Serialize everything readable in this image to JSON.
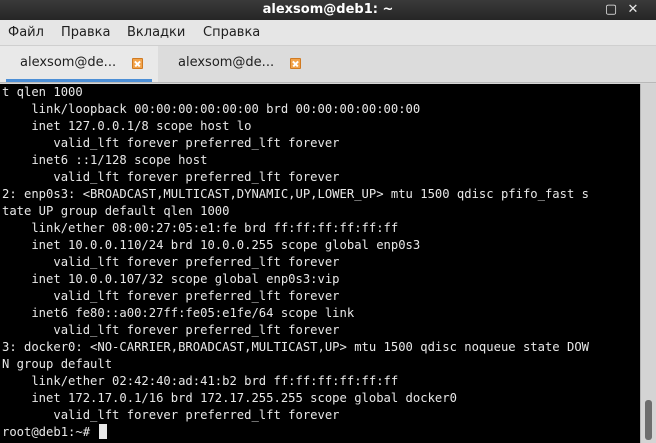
{
  "window": {
    "title": "alexsom@deb1: ~",
    "close_glyph": "✕",
    "maximize_glyph": "▢"
  },
  "menubar": {
    "items": [
      "Файл",
      "Правка",
      "Вкладки",
      "Справка"
    ]
  },
  "tabs": [
    {
      "label": "alexsom@de...",
      "active": true
    },
    {
      "label": "alexsom@de...",
      "active": false
    }
  ],
  "terminal": {
    "lines": [
      "t qlen 1000",
      "    link/loopback 00:00:00:00:00:00 brd 00:00:00:00:00:00",
      "    inet 127.0.0.1/8 scope host lo",
      "       valid_lft forever preferred_lft forever",
      "    inet6 ::1/128 scope host",
      "       valid_lft forever preferred_lft forever",
      "2: enp0s3: <BROADCAST,MULTICAST,DYNAMIC,UP,LOWER_UP> mtu 1500 qdisc pfifo_fast s",
      "tate UP group default qlen 1000",
      "    link/ether 08:00:27:05:e1:fe brd ff:ff:ff:ff:ff:ff",
      "    inet 10.0.0.110/24 brd 10.0.0.255 scope global enp0s3",
      "       valid_lft forever preferred_lft forever",
      "    inet 10.0.0.107/32 scope global enp0s3:vip",
      "       valid_lft forever preferred_lft forever",
      "    inet6 fe80::a00:27ff:fe05:e1fe/64 scope link",
      "       valid_lft forever preferred_lft forever",
      "3: docker0: <NO-CARRIER,BROADCAST,MULTICAST,UP> mtu 1500 qdisc noqueue state DOW",
      "N group default",
      "    link/ether 02:42:40:ad:41:b2 brd ff:ff:ff:ff:ff:ff",
      "    inet 172.17.0.1/16 brd 172.17.255.255 scope global docker0",
      "       valid_lft forever preferred_lft forever"
    ],
    "prompt": "root@deb1:~# "
  },
  "colors": {
    "terminal_bg": "#000000",
    "terminal_fg": "#e8e8e8",
    "titlebar_bg": "#2e2e2e",
    "tab_accent": "#4d8fd6",
    "tab_close": "#f2a34a"
  }
}
